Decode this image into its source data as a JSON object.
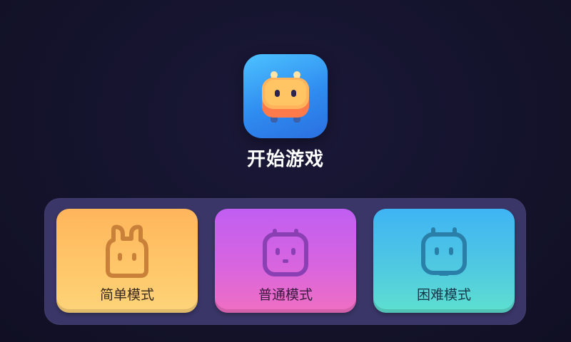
{
  "start": {
    "label": "开始游戏",
    "icon": "robot-icon"
  },
  "modes": [
    {
      "key": "easy",
      "label": "简单模式",
      "icon": "bunny-icon"
    },
    {
      "key": "normal",
      "label": "普通模式",
      "icon": "robot-face-icon"
    },
    {
      "key": "hard",
      "label": "困难模式",
      "icon": "robot-antenna-icon"
    }
  ],
  "colors": {
    "background": "#13122b",
    "panel": "#3a3668",
    "easy": "#ffc86a",
    "normal": "#d865df",
    "hard": "#4fc8e2",
    "app_icon": "#3aa6f8"
  }
}
